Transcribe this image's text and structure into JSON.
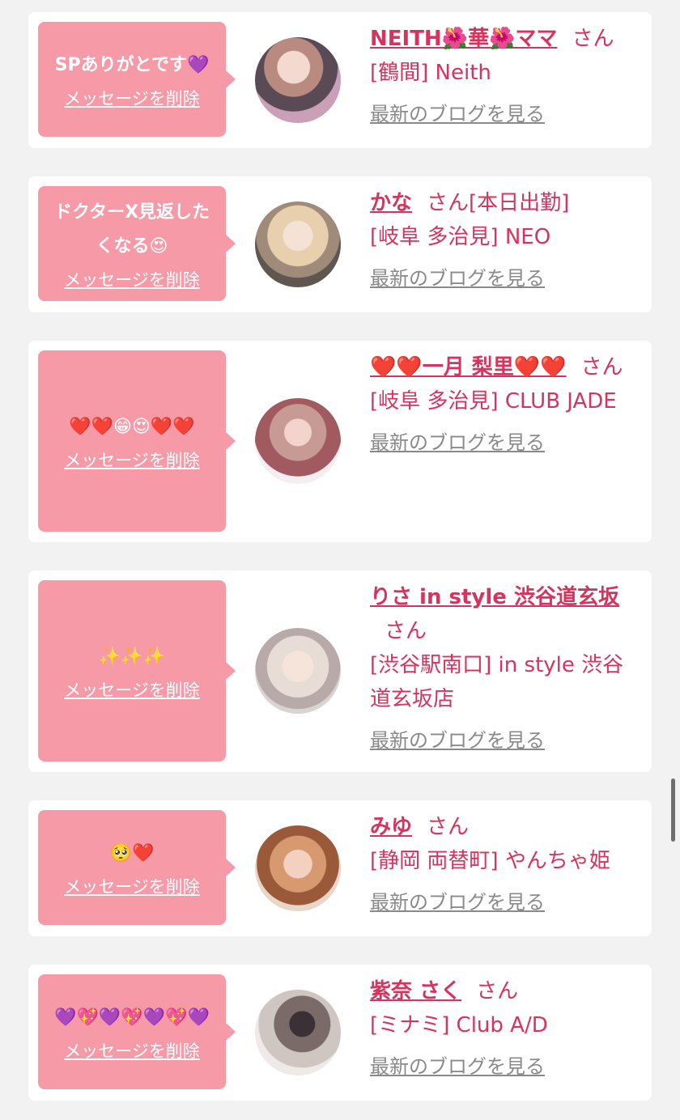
{
  "colors": {
    "page_bg": "#f2f2f2",
    "card_bg": "#ffffff",
    "bubble_bg": "#f79aa8",
    "accent": "#d6345e",
    "link_gray": "#8a8a8a"
  },
  "messages": [
    {
      "message": "SPありがとです💜",
      "delete_label": "メッセージを削除",
      "name": "NEITH🌺華🌺ママ",
      "suffix": "さん",
      "shop": "[鶴間] Neith",
      "blog_label": "最新のブログを見る",
      "avatar_icon": "avatar-photo"
    },
    {
      "message": "ドクターX見返したくなる😍",
      "delete_label": "メッセージを削除",
      "name": "かな",
      "suffix": "さん[本日出勤]",
      "shop": "[岐阜 多治見] NEO",
      "blog_label": "最新のブログを見る",
      "avatar_icon": "avatar-photo"
    },
    {
      "message": "❤️❤️😁😍❤️❤️",
      "delete_label": "メッセージを削除",
      "name": "❤️❤️一月 梨里❤️❤️",
      "suffix": "さん",
      "shop": "[岐阜 多治見] CLUB JADE",
      "blog_label": "最新のブログを見る",
      "avatar_icon": "avatar-photo"
    },
    {
      "message": "✨✨✨",
      "delete_label": "メッセージを削除",
      "name": "りさ in style 渋谷道玄坂",
      "suffix": "さん",
      "shop": "[渋谷駅南口] in style 渋谷道玄坂店",
      "blog_label": "最新のブログを見る",
      "avatar_icon": "avatar-photo"
    },
    {
      "message": "🥺❤️",
      "delete_label": "メッセージを削除",
      "name": "みゆ",
      "suffix": "さん",
      "shop": "[静岡 両替町] やんちゃ姫",
      "blog_label": "最新のブログを見る",
      "avatar_icon": "avatar-photo"
    },
    {
      "message": "💜💖💜💖💜💖💜",
      "delete_label": "メッセージを削除",
      "name": "紫奈 さく",
      "suffix": "さん",
      "shop": "[ミナミ] Club A/D",
      "blog_label": "最新のブログを見る",
      "avatar_icon": "avatar-photo"
    }
  ]
}
